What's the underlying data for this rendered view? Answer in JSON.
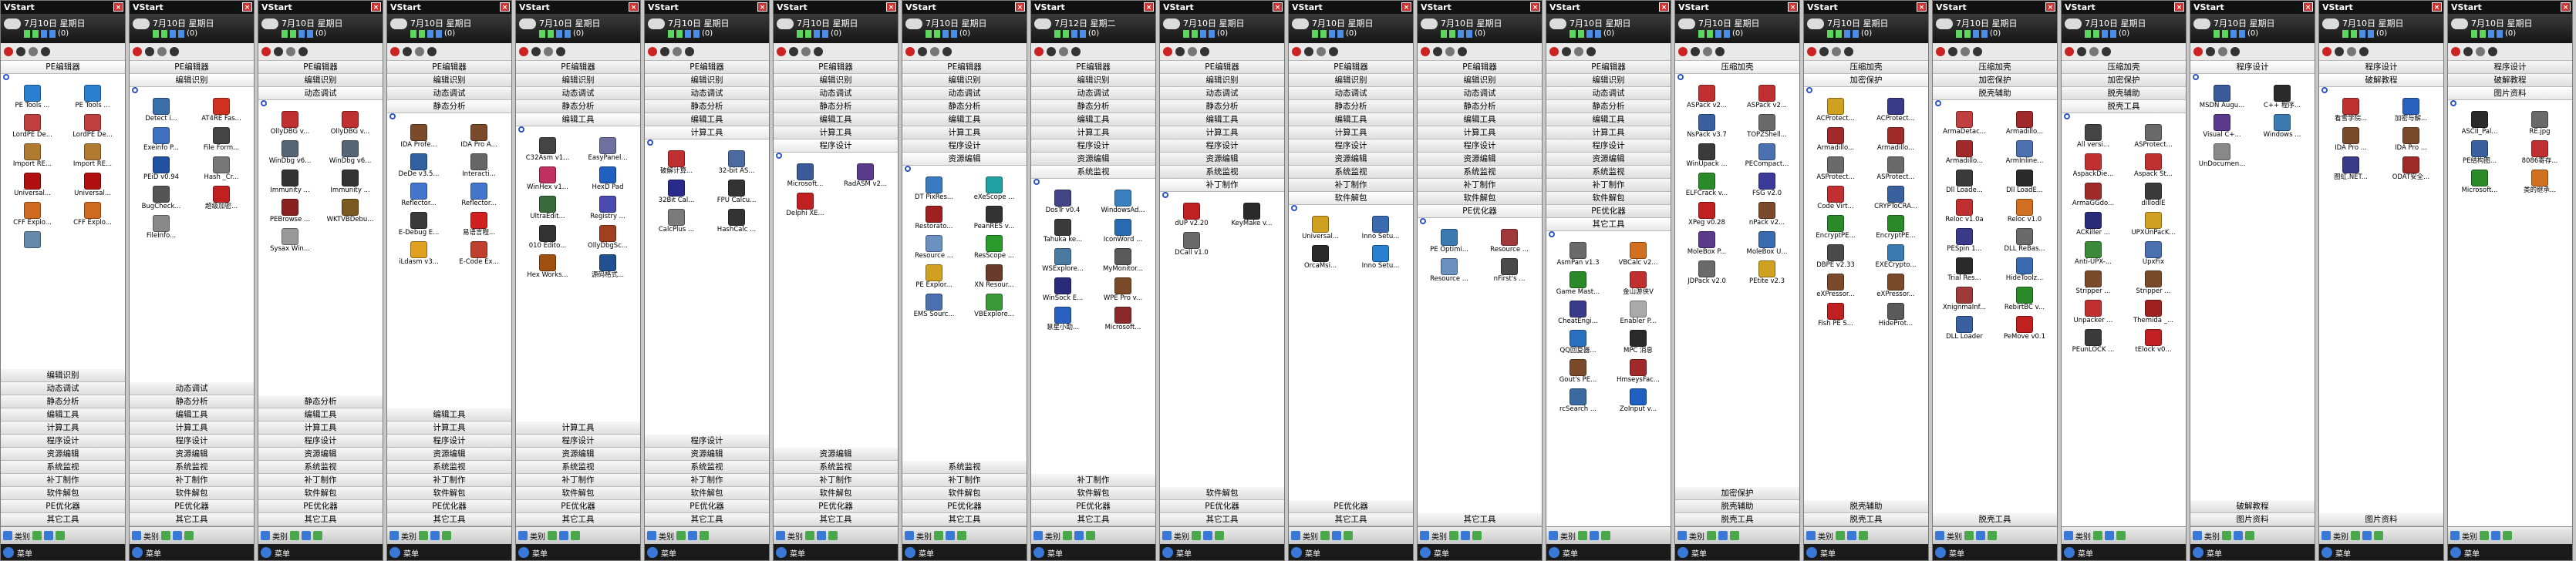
{
  "app_title": "VStart",
  "close_glyph": "×",
  "tray_count": "(0)",
  "bottom_bar": {
    "label1": "类别",
    "label2": "菜单"
  },
  "colors": {
    "titlebar": "#111111",
    "panel_bg": "#ffffff",
    "category_bar": "#e6e6e6",
    "search_icon": "#2d54c8"
  },
  "panels": [
    {
      "date": "7月10日 星期日",
      "top": [
        "PE编辑器"
      ],
      "icons": [
        [
          "PE Tools ...",
          "#2a7fd1"
        ],
        [
          "PE Tools ...",
          "#2a7fd1"
        ],
        [
          "LordPE De...",
          "#c04040"
        ],
        [
          "LordPE De...",
          "#c04040"
        ],
        [
          "Import RE...",
          "#b07a30"
        ],
        [
          "Import RE...",
          "#b07a30"
        ],
        [
          "Universal...",
          "#b01010"
        ],
        [
          "Universal...",
          "#b01010"
        ],
        [
          "CFF Explo...",
          "#d06a20"
        ],
        [
          "CFF Explo...",
          "#d06a20"
        ],
        [
          "",
          "#6688aa"
        ]
      ],
      "bottom": [
        "编辑识别",
        "动态调试",
        "静态分析",
        "编辑工具",
        "计算工具",
        "程序设计",
        "资源编辑",
        "系统监视",
        "补丁制作",
        "软件解包",
        "PE优化器",
        "其它工具"
      ]
    },
    {
      "date": "7月10日 星期日",
      "top": [
        "PE编辑器",
        "编辑识别"
      ],
      "icons": [
        [
          "Detect i...",
          "#3a6ea8"
        ],
        [
          "AT4RE Fas...",
          "#d03020"
        ],
        [
          "Exeinfo P...",
          "#4070c0"
        ],
        [
          "File Form...",
          "#444444"
        ],
        [
          "PEiD v0.94",
          "#2050a0"
        ],
        [
          "Hash _Cr...",
          "#777777"
        ],
        [
          "BugCheck...",
          "#555555"
        ],
        [
          "超级加密...",
          "#c02020"
        ],
        [
          "FileInfo...",
          "#888888"
        ]
      ],
      "bottom": [
        "动态调试",
        "静态分析",
        "编辑工具",
        "计算工具",
        "程序设计",
        "资源编辑",
        "系统监视",
        "补丁制作",
        "软件解包",
        "PE优化器",
        "其它工具"
      ]
    },
    {
      "date": "7月10日 星期日",
      "top": [
        "PE编辑器",
        "编辑识别",
        "动态调试"
      ],
      "icons": [
        [
          "OllyDBG v...",
          "#c03030"
        ],
        [
          "OllyDBG v...",
          "#c03030"
        ],
        [
          "WinDbg v6...",
          "#556677"
        ],
        [
          "WinDbg v6...",
          "#556677"
        ],
        [
          "Immunity ...",
          "#333333"
        ],
        [
          "Immunity ...",
          "#333333"
        ],
        [
          "PEBrowse ...",
          "#8a2020"
        ],
        [
          "WKTVBDebu...",
          "#7a5a20"
        ],
        [
          "Sysax Win...",
          "#999999"
        ]
      ],
      "bottom": [
        "静态分析",
        "编辑工具",
        "计算工具",
        "程序设计",
        "资源编辑",
        "系统监视",
        "补丁制作",
        "软件解包",
        "PE优化器",
        "其它工具"
      ]
    },
    {
      "date": "7月10日 星期日",
      "top": [
        "PE编辑器",
        "编辑识别",
        "动态调试",
        "静态分析"
      ],
      "icons": [
        [
          "IDA Profe...",
          "#7a4a2a"
        ],
        [
          "IDA Pro A...",
          "#7a4a2a"
        ],
        [
          "DeDe v3.5...",
          "#3060a0"
        ],
        [
          "Interacti...",
          "#666666"
        ],
        [
          "Reflector...",
          "#4477cc"
        ],
        [
          "Reflector...",
          "#4477cc"
        ],
        [
          "E-Debug E...",
          "#3a3a3a"
        ],
        [
          "易语言程...",
          "#d02020"
        ],
        [
          "iLdasm v3...",
          "#e0a020"
        ],
        [
          "E-Code Ex...",
          "#c04030"
        ]
      ],
      "bottom": [
        "编辑工具",
        "计算工具",
        "程序设计",
        "资源编辑",
        "系统监视",
        "补丁制作",
        "软件解包",
        "PE优化器",
        "其它工具"
      ]
    },
    {
      "date": "7月10日 星期日",
      "top": [
        "PE编辑器",
        "编辑识别",
        "动态调试",
        "静态分析",
        "编辑工具"
      ],
      "icons": [
        [
          "C32Asm v1...",
          "#444444"
        ],
        [
          "EasyPanel...",
          "#7070a0"
        ],
        [
          "WinHex v1...",
          "#c03060"
        ],
        [
          "HexD Pad",
          "#2060c0"
        ],
        [
          "UltraEdit...",
          "#3a6a3a"
        ],
        [
          "Registry ...",
          "#4a4ab0"
        ],
        [
          "010 Edito...",
          "#333333"
        ],
        [
          "OllyDbgSc...",
          "#a04020"
        ],
        [
          "Hex Works...",
          "#a05010"
        ],
        [
          "源码格式...",
          "#205090"
        ]
      ],
      "bottom": [
        "计算工具",
        "程序设计",
        "资源编辑",
        "系统监视",
        "补丁制作",
        "软件解包",
        "PE优化器",
        "其它工具"
      ]
    },
    {
      "date": "7月10日 星期日",
      "top": [
        "PE编辑器",
        "编辑识别",
        "动态调试",
        "静态分析",
        "编辑工具",
        "计算工具"
      ],
      "icons": [
        [
          "破解计算...",
          "#c03030"
        ],
        [
          "32-bit AS...",
          "#4a6aa0"
        ],
        [
          "32Bit Cal...",
          "#2a2a8a"
        ],
        [
          "FPU Calcu...",
          "#333333"
        ],
        [
          "CalcPlus ...",
          "#7a7a7a"
        ],
        [
          "HashCalc ...",
          "#333333"
        ]
      ],
      "bottom": [
        "程序设计",
        "资源编辑",
        "系统监视",
        "补丁制作",
        "软件解包",
        "PE优化器",
        "其它工具"
      ]
    },
    {
      "date": "7月10日 星期日",
      "top": [
        "PE编辑器",
        "编辑识别",
        "动态调试",
        "静态分析",
        "编辑工具",
        "计算工具",
        "程序设计"
      ],
      "icons": [
        [
          "Microsoft...",
          "#3a5a9a"
        ],
        [
          "RadASM v2...",
          "#5a3a8a"
        ],
        [
          "Delphi XE...",
          "#c02020"
        ]
      ],
      "bottom": [
        "资源编辑",
        "系统监视",
        "补丁制作",
        "软件解包",
        "PE优化器",
        "其它工具"
      ]
    },
    {
      "date": "7月10日 星期日",
      "top": [
        "PE编辑器",
        "编辑识别",
        "动态调试",
        "静态分析",
        "编辑工具",
        "计算工具",
        "程序设计",
        "资源编辑"
      ],
      "icons": [
        [
          "DT PixRes...",
          "#3a7ac0"
        ],
        [
          "eXeScope ...",
          "#20a0a0"
        ],
        [
          "Restorato...",
          "#a02020"
        ],
        [
          "PeanRES v...",
          "#333333"
        ],
        [
          "Resource ...",
          "#6a90c0"
        ],
        [
          "ResScope ...",
          "#2a9a2a"
        ],
        [
          "PE Explor...",
          "#d0a020"
        ],
        [
          "XN Resour...",
          "#6a3a2a"
        ],
        [
          "EMS Sourc...",
          "#4a70b0"
        ],
        [
          "VBExplore...",
          "#3a9a3a"
        ]
      ],
      "bottom": [
        "系统监视",
        "补丁制作",
        "软件解包",
        "PE优化器",
        "其它工具"
      ]
    },
    {
      "date": "7月12日 星期二",
      "top": [
        "PE编辑器",
        "编辑识别",
        "动态调试",
        "静态分析",
        "编辑工具",
        "计算工具",
        "程序设计",
        "资源编辑",
        "系统监视"
      ],
      "icons": [
        [
          "DosTr v0.4",
          "#444488"
        ],
        [
          "WindowsAd...",
          "#3a80c0"
        ],
        [
          "Tahuka ke...",
          "#3a3a3a"
        ],
        [
          "IconWord ...",
          "#2a6ab0"
        ],
        [
          "WSExplore...",
          "#4a7aa0"
        ],
        [
          "MyMonitor...",
          "#5a5a5a"
        ],
        [
          "WinSock E...",
          "#2a2a7a"
        ],
        [
          "WPE Pro v...",
          "#7a4a2a"
        ],
        [
          "慧星小助...",
          "#2a60c0"
        ],
        [
          "Microsoft...",
          "#8a2a2a"
        ]
      ],
      "bottom": [
        "补丁制作",
        "软件解包",
        "PE优化器",
        "其它工具"
      ]
    },
    {
      "date": "7月10日 星期日",
      "top": [
        "PE编辑器",
        "编辑识别",
        "动态调试",
        "静态分析",
        "编辑工具",
        "计算工具",
        "程序设计",
        "资源编辑",
        "系统监视",
        "补丁制作"
      ],
      "icons": [
        [
          "dUP v2.20",
          "#c02020"
        ],
        [
          "KeyMake v...",
          "#2a2a2a"
        ],
        [
          "DCall v1.0",
          "#6a6a6a"
        ]
      ],
      "bottom": [
        "软件解包",
        "PE优化器",
        "其它工具"
      ]
    },
    {
      "date": "7月10日 星期日",
      "top": [
        "PE编辑器",
        "编辑识别",
        "动态调试",
        "静态分析",
        "编辑工具",
        "计算工具",
        "程序设计",
        "资源编辑",
        "系统监视",
        "补丁制作",
        "软件解包"
      ],
      "icons": [
        [
          "Universal...",
          "#d0a020"
        ],
        [
          "Inno Setu...",
          "#3a6ab0"
        ],
        [
          "OrcaMsi...",
          "#2a2a2a"
        ],
        [
          "Inno Setu...",
          "#2a80d0"
        ]
      ],
      "bottom": [
        "PE优化器",
        "其它工具"
      ]
    },
    {
      "date": "7月10日 星期日",
      "top": [
        "PE编辑器",
        "编辑识别",
        "动态调试",
        "静态分析",
        "编辑工具",
        "计算工具",
        "程序设计",
        "资源编辑",
        "系统监视",
        "补丁制作",
        "软件解包",
        "PE优化器"
      ],
      "icons": [
        [
          "PE Optimi...",
          "#3a7ab0"
        ],
        [
          "Resource ...",
          "#a03a3a"
        ],
        [
          "Resource ...",
          "#6a90c0"
        ],
        [
          "nFirst's ...",
          "#4a4a4a"
        ]
      ],
      "bottom": [
        "其它工具"
      ]
    },
    {
      "date": "7月10日 星期日",
      "top": [
        "PE编辑器",
        "编辑识别",
        "动态调试",
        "静态分析",
        "编辑工具",
        "计算工具",
        "程序设计",
        "资源编辑",
        "系统监视",
        "补丁制作",
        "软件解包",
        "PE优化器",
        "其它工具"
      ],
      "icons": [
        [
          "AsmPan v1.3",
          "#6a6a6a"
        ],
        [
          "VBCalc v2...",
          "#d07020"
        ],
        [
          "Game Mast...",
          "#2a8a2a"
        ],
        [
          "金山游侠V",
          "#c03030"
        ],
        [
          "CheatEngi...",
          "#3a3a8a"
        ],
        [
          "Enabler P...",
          "#aaaaaa"
        ],
        [
          "QQ回复器...",
          "#2a70c0"
        ],
        [
          "MPC 消息",
          "#2a2a2a"
        ],
        [
          "Gout's PE...",
          "#7a4a2a"
        ],
        [
          "HmseysFac...",
          "#a02a2a"
        ],
        [
          "rcSearch ...",
          "#3a6aa0"
        ],
        [
          "ZoInput v...",
          "#2060c0"
        ]
      ],
      "bottom": []
    },
    {
      "date": "7月10日 星期日",
      "top": [
        "压缩加壳"
      ],
      "icons": [
        [
          "ASPack v2...",
          "#c03030"
        ],
        [
          "ASPack v2...",
          "#c03030"
        ],
        [
          "NsPack v3.7",
          "#3a60a0"
        ],
        [
          "TOPZShell...",
          "#6a6a6a"
        ],
        [
          "WinUpack ...",
          "#3a3a3a"
        ],
        [
          "PECompact...",
          "#4a70b0"
        ],
        [
          "ELFCrack v...",
          "#2a8a2a"
        ],
        [
          "FSG v2.0",
          "#3a3a9a"
        ],
        [
          "XPeg v0.28",
          "#c02020"
        ],
        [
          "nPack v2...",
          "#7a4a2a"
        ],
        [
          "MoleBox P...",
          "#5a3a8a"
        ],
        [
          "MoleBox U...",
          "#3a6ab0"
        ],
        [
          "JDPack v2.0",
          "#6a6a6a"
        ],
        [
          "PEtite v2.3",
          "#d0a020"
        ]
      ],
      "bottom": [
        "加密保护",
        "脱壳辅助",
        "脱壳工具"
      ]
    },
    {
      "date": "7月10日 星期日",
      "top": [
        "压缩加壳",
        "加密保护"
      ],
      "icons": [
        [
          "ACProtect...",
          "#d0a020"
        ],
        [
          "ACProtect...",
          "#3a3a8a"
        ],
        [
          "Armadillo...",
          "#a02a2a"
        ],
        [
          "Armadillo...",
          "#a02a2a"
        ],
        [
          "ASProtect...",
          "#6a6a6a"
        ],
        [
          "ASProtect...",
          "#6a6a6a"
        ],
        [
          "Code Virt...",
          "#c03030"
        ],
        [
          "CRYPToCRA...",
          "#3a60a0"
        ],
        [
          "EncryptPE...",
          "#2a8a2a"
        ],
        [
          "EncryptPE...",
          "#2a8a2a"
        ],
        [
          "DBPE v2.33",
          "#4a4a4a"
        ],
        [
          "EXECrypto...",
          "#3a7ab0"
        ],
        [
          "eXPressor...",
          "#7a4a2a"
        ],
        [
          "eXPressor...",
          "#7a4a2a"
        ],
        [
          "Fish PE S...",
          "#c02020"
        ],
        [
          "HideProt...",
          "#5a5a5a"
        ]
      ],
      "bottom": [
        "脱壳辅助",
        "脱壳工具"
      ]
    },
    {
      "date": "7月10日 星期日",
      "top": [
        "压缩加壳",
        "加密保护",
        "脱壳辅助"
      ],
      "icons": [
        [
          "ArmaDetac...",
          "#c04040"
        ],
        [
          "Armadillo...",
          "#a02a2a"
        ],
        [
          "Armadillo...",
          "#a02a2a"
        ],
        [
          "ArmInline...",
          "#4a70b0"
        ],
        [
          "Dll Loade...",
          "#3a3a3a"
        ],
        [
          "Dll LoadE...",
          "#2a2a2a"
        ],
        [
          "Reloc v1.0a",
          "#c03030"
        ],
        [
          "Reloc v1.0",
          "#d07020"
        ],
        [
          "PESpin 1...",
          "#3a3a8a"
        ],
        [
          "DLL ReBas...",
          "#6a6a6a"
        ],
        [
          "Trial Res...",
          "#2a2a2a"
        ],
        [
          "HideToolz...",
          "#3a6ab0"
        ],
        [
          "XnignmaInf...",
          "#a03a3a"
        ],
        [
          "RebirtBC v...",
          "#2a8a2a"
        ],
        [
          "DLL Loader",
          "#3a60a0"
        ],
        [
          "PeMove v0.1",
          "#c02020"
        ]
      ],
      "bottom": [
        "脱壳工具"
      ]
    },
    {
      "date": "7月10日 星期日",
      "top": [
        "压缩加壳",
        "加密保护",
        "脱壳辅助",
        "脱壳工具"
      ],
      "icons": [
        [
          "All versi...",
          "#444444"
        ],
        [
          "ASProtect...",
          "#6a6a6a"
        ],
        [
          "AspackDie...",
          "#c03030"
        ],
        [
          "Aspack St...",
          "#c03030"
        ],
        [
          "ArmaGGdo...",
          "#a02a2a"
        ],
        [
          "dillodIE",
          "#3a3a3a"
        ],
        [
          "ACKiller ...",
          "#2a2a7a"
        ],
        [
          "UPXUnPacK...",
          "#d0a020"
        ],
        [
          "Anti-UPX-...",
          "#3a8a3a"
        ],
        [
          "UpxFix",
          "#4a70b0"
        ],
        [
          "Stripper ...",
          "#7a4a2a"
        ],
        [
          "Stripper ...",
          "#7a4a2a"
        ],
        [
          "Unpacker ...",
          "#c03030"
        ],
        [
          "Themida _...",
          "#a02020"
        ],
        [
          "PEunLOCK ...",
          "#3a3a3a"
        ],
        [
          "tElock v0...",
          "#c02020"
        ]
      ],
      "bottom": []
    },
    {
      "date": "7月10日 星期日",
      "top": [
        "程序设计"
      ],
      "icons": [
        [
          "MSDN Augu...",
          "#3a5a9a"
        ],
        [
          "C++ 程序...",
          "#2a2a2a"
        ],
        [
          "Visual C+...",
          "#5a3a8a"
        ],
        [
          "Windows ...",
          "#3a7ab0"
        ],
        [
          "UnDocumen...",
          "#888888"
        ]
      ],
      "bottom": [
        "破解教程",
        "图片资料"
      ]
    },
    {
      "date": "7月10日 星期日",
      "top": [
        "程序设计",
        "破解教程"
      ],
      "icons": [
        [
          "看雪学院...",
          "#c03030"
        ],
        [
          "加密与解...",
          "#2a60c0"
        ],
        [
          "IDA Pro ...",
          "#7a4a2a"
        ],
        [
          "IDA Pro ...",
          "#7a4a2a"
        ],
        [
          "图虹.NET...",
          "#3a3a8a"
        ],
        [
          "ODAT安全...",
          "#a02a2a"
        ]
      ],
      "bottom": [
        "图片资料"
      ]
    },
    {
      "date": "7月10日 星期日",
      "top": [
        "程序设计",
        "破解教程",
        "图片资料"
      ],
      "icons": [
        [
          "ASCII_Pal...",
          "#2a2a2a"
        ],
        [
          "RE.jpg",
          "#6a6a6a"
        ],
        [
          "PE结构图...",
          "#3a60a0"
        ],
        [
          "8086寄存...",
          "#c03030"
        ],
        [
          "Microsoft...",
          "#2a8a2a"
        ],
        [
          "类的继承...",
          "#d07020"
        ]
      ],
      "bottom": []
    }
  ]
}
